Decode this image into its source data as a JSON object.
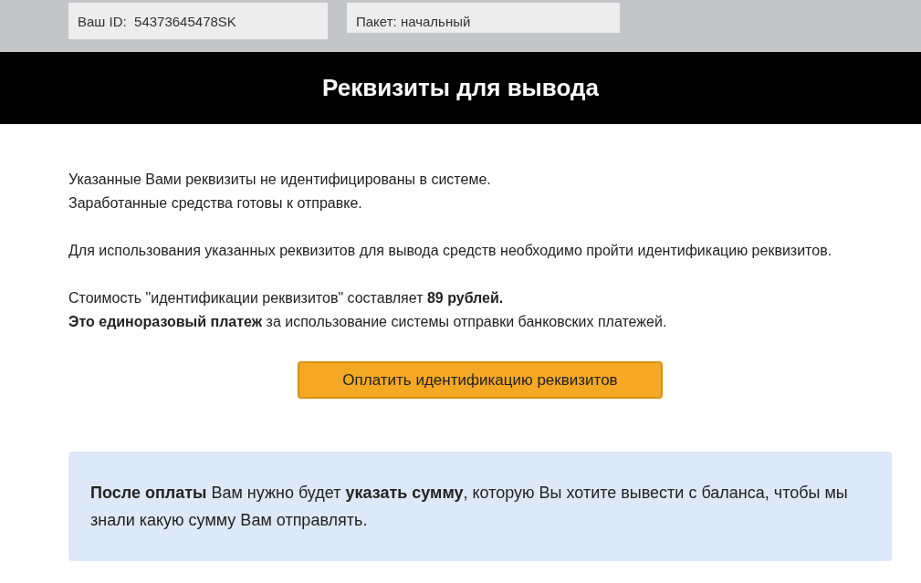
{
  "account_bar": {
    "fields": [
      {
        "label": "Ваш ID:",
        "value": "54373645478SK"
      },
      {
        "label": "Пакет:",
        "value": "начальный"
      }
    ]
  },
  "header": {
    "title": "Реквизиты для вывода"
  },
  "paragraphs": [
    [
      "Указанные Вами реквизиты не идентифицированы в системе.",
      "Заработанные средства готовы к отправке."
    ],
    [
      "Для использования указанных реквизитов для вывода средств необходимо пройти идентификацию реквизитов."
    ],
    [
      "Стоимость \"идентификации реквизитов\" составляет **89 рублей.**",
      "**Это единоразовый платеж** за использование системы отправки банковских платежей."
    ]
  ],
  "pay_button": {
    "label": "Оплатить идентификацию реквизитов"
  },
  "info_box": {
    "text": "**После оплаты** Вам нужно будет **указать сумму**, которую Вы хотите вывести с баланса, чтобы мы знали какую сумму Вам отправлять."
  }
}
